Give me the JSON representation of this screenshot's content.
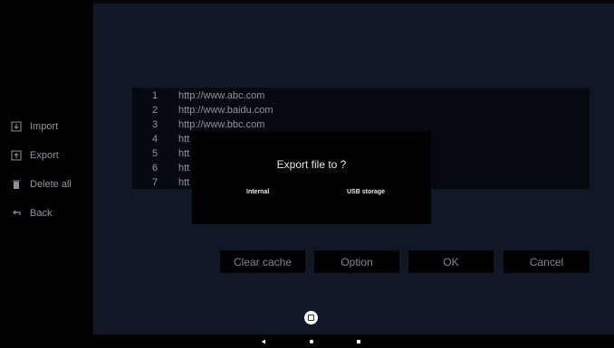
{
  "sidebar": {
    "items": [
      {
        "label": "Import",
        "icon": "import-icon"
      },
      {
        "label": "Export",
        "icon": "export-icon"
      },
      {
        "label": "Delete all",
        "icon": "trash-icon"
      },
      {
        "label": "Back",
        "icon": "back-arrow-icon"
      }
    ]
  },
  "list": {
    "rows": [
      {
        "num": "1",
        "url": "http://www.abc.com"
      },
      {
        "num": "2",
        "url": "http://www.baidu.com"
      },
      {
        "num": "3",
        "url": "http://www.bbc.com"
      },
      {
        "num": "4",
        "url": "htt"
      },
      {
        "num": "5",
        "url": "htt"
      },
      {
        "num": "6",
        "url": "htt"
      },
      {
        "num": "7",
        "url": "htt"
      }
    ]
  },
  "buttons": {
    "clear_cache": "Clear cache",
    "option": "Option",
    "ok": "OK",
    "cancel": "Cancel"
  },
  "dialog": {
    "title": "Export file to ?",
    "options": [
      "Internal",
      "USB storage"
    ]
  },
  "navbar": {
    "icons": [
      "back-triangle-icon",
      "home-dot-icon",
      "recents-square-icon"
    ]
  },
  "colors": {
    "background": "#111825",
    "sidebar": "#000000",
    "text_muted": "#8e949d",
    "dialog_text": "#e6e8ea"
  }
}
